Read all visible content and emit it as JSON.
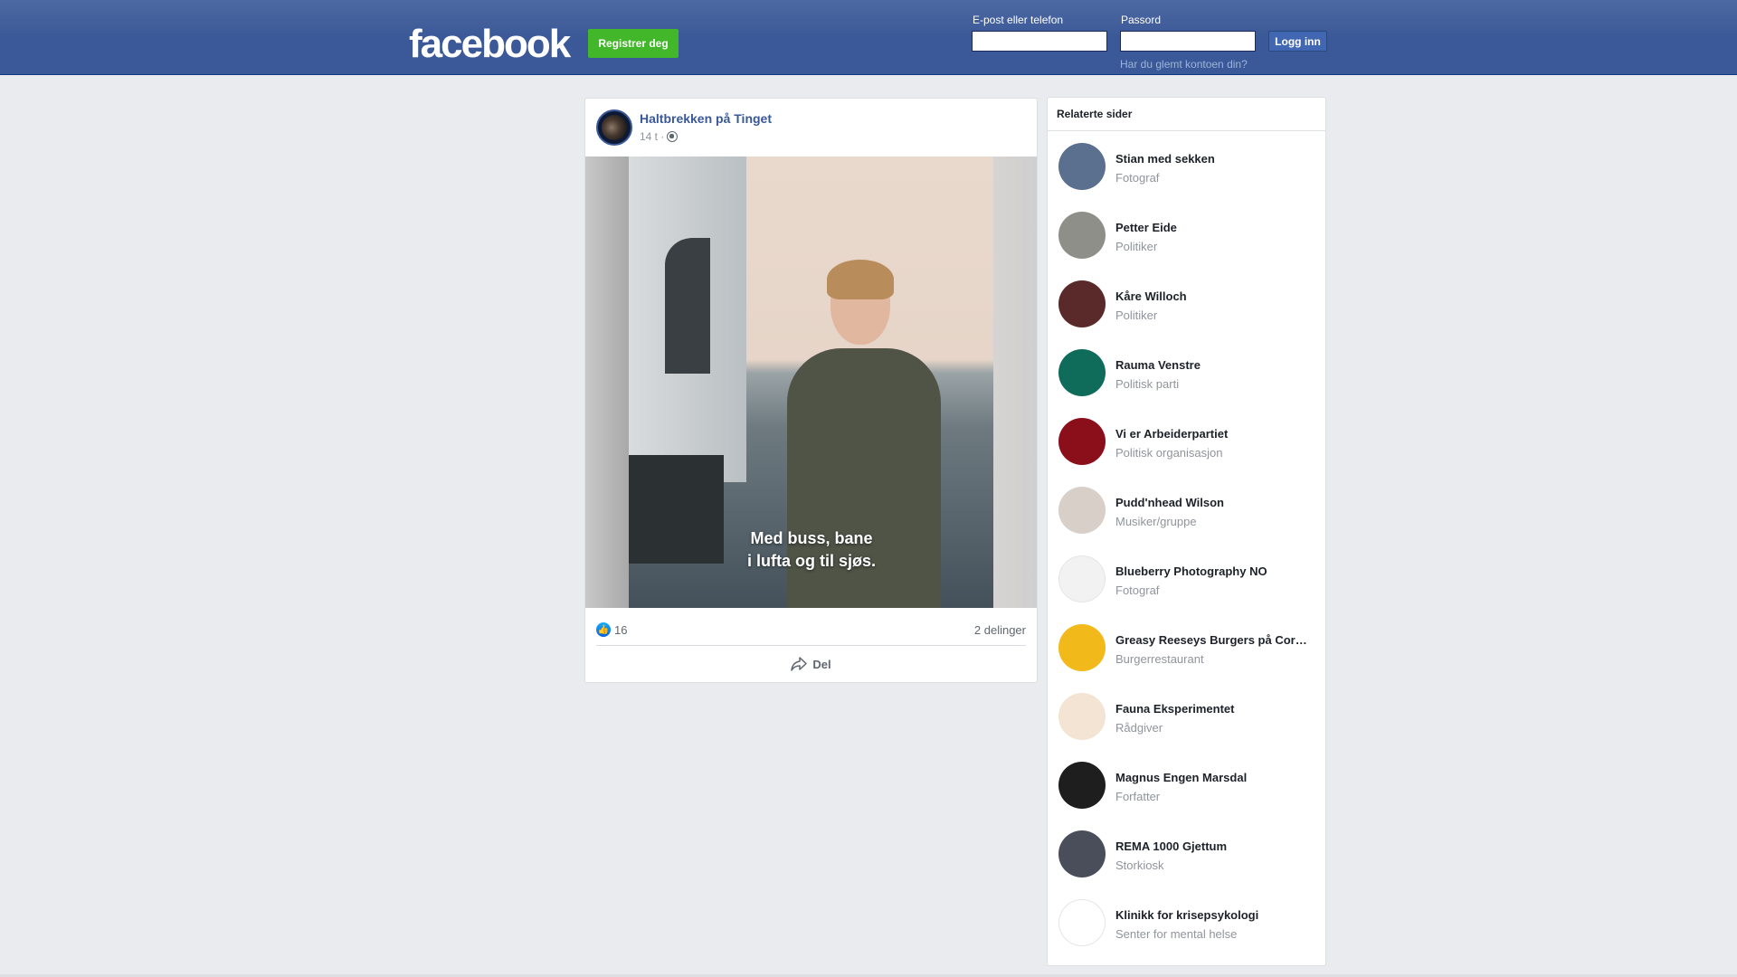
{
  "header": {
    "logo": "facebook",
    "register_label": "Registrer deg",
    "email_label": "E-post eller telefon",
    "password_label": "Passord",
    "login_label": "Logg inn",
    "forgot_label": "Har du glemt kontoen din?"
  },
  "post": {
    "author": "Haltbrekken på Tinget",
    "time": "14 t ·",
    "caption_line1": "Med buss, bane",
    "caption_line2": "i lufta og til sjøs.",
    "likes": "16",
    "shares": "2 delinger",
    "share_label": "Del"
  },
  "related": {
    "title": "Relaterte sider",
    "items": [
      {
        "name": "Stian med sekken",
        "category": "Fotograf",
        "color": "#5b6f8f"
      },
      {
        "name": "Petter Eide",
        "category": "Politiker",
        "color": "#8e8f88"
      },
      {
        "name": "Kåre Willoch",
        "category": "Politiker",
        "color": "#5a2a2a"
      },
      {
        "name": "Rauma Venstre",
        "category": "Politisk parti",
        "color": "#0f6b5a"
      },
      {
        "name": "Vi er Arbeiderpartiet",
        "category": "Politisk organisasjon",
        "color": "#8b0f1b"
      },
      {
        "name": "Pudd'nhead Wilson",
        "category": "Musiker/gruppe",
        "color": "#d8cfc8"
      },
      {
        "name": "Blueberry Photography NO",
        "category": "Fotograf",
        "color": "#f2f2f2"
      },
      {
        "name": "Greasy Reeseys Burgers på Cor…",
        "category": "Burgerrestaurant",
        "color": "#f1b91a"
      },
      {
        "name": "Fauna Eksperimentet",
        "category": "Rådgiver",
        "color": "#f3e4d4"
      },
      {
        "name": "Magnus Engen Marsdal",
        "category": "Forfatter",
        "color": "#1e1e1e"
      },
      {
        "name": "REMA 1000 Gjettum",
        "category": "Storkiosk",
        "color": "#4a4e5a"
      },
      {
        "name": "Klinikk for krisepsykologi",
        "category": "Senter for mental helse",
        "color": "#ffffff"
      }
    ]
  }
}
